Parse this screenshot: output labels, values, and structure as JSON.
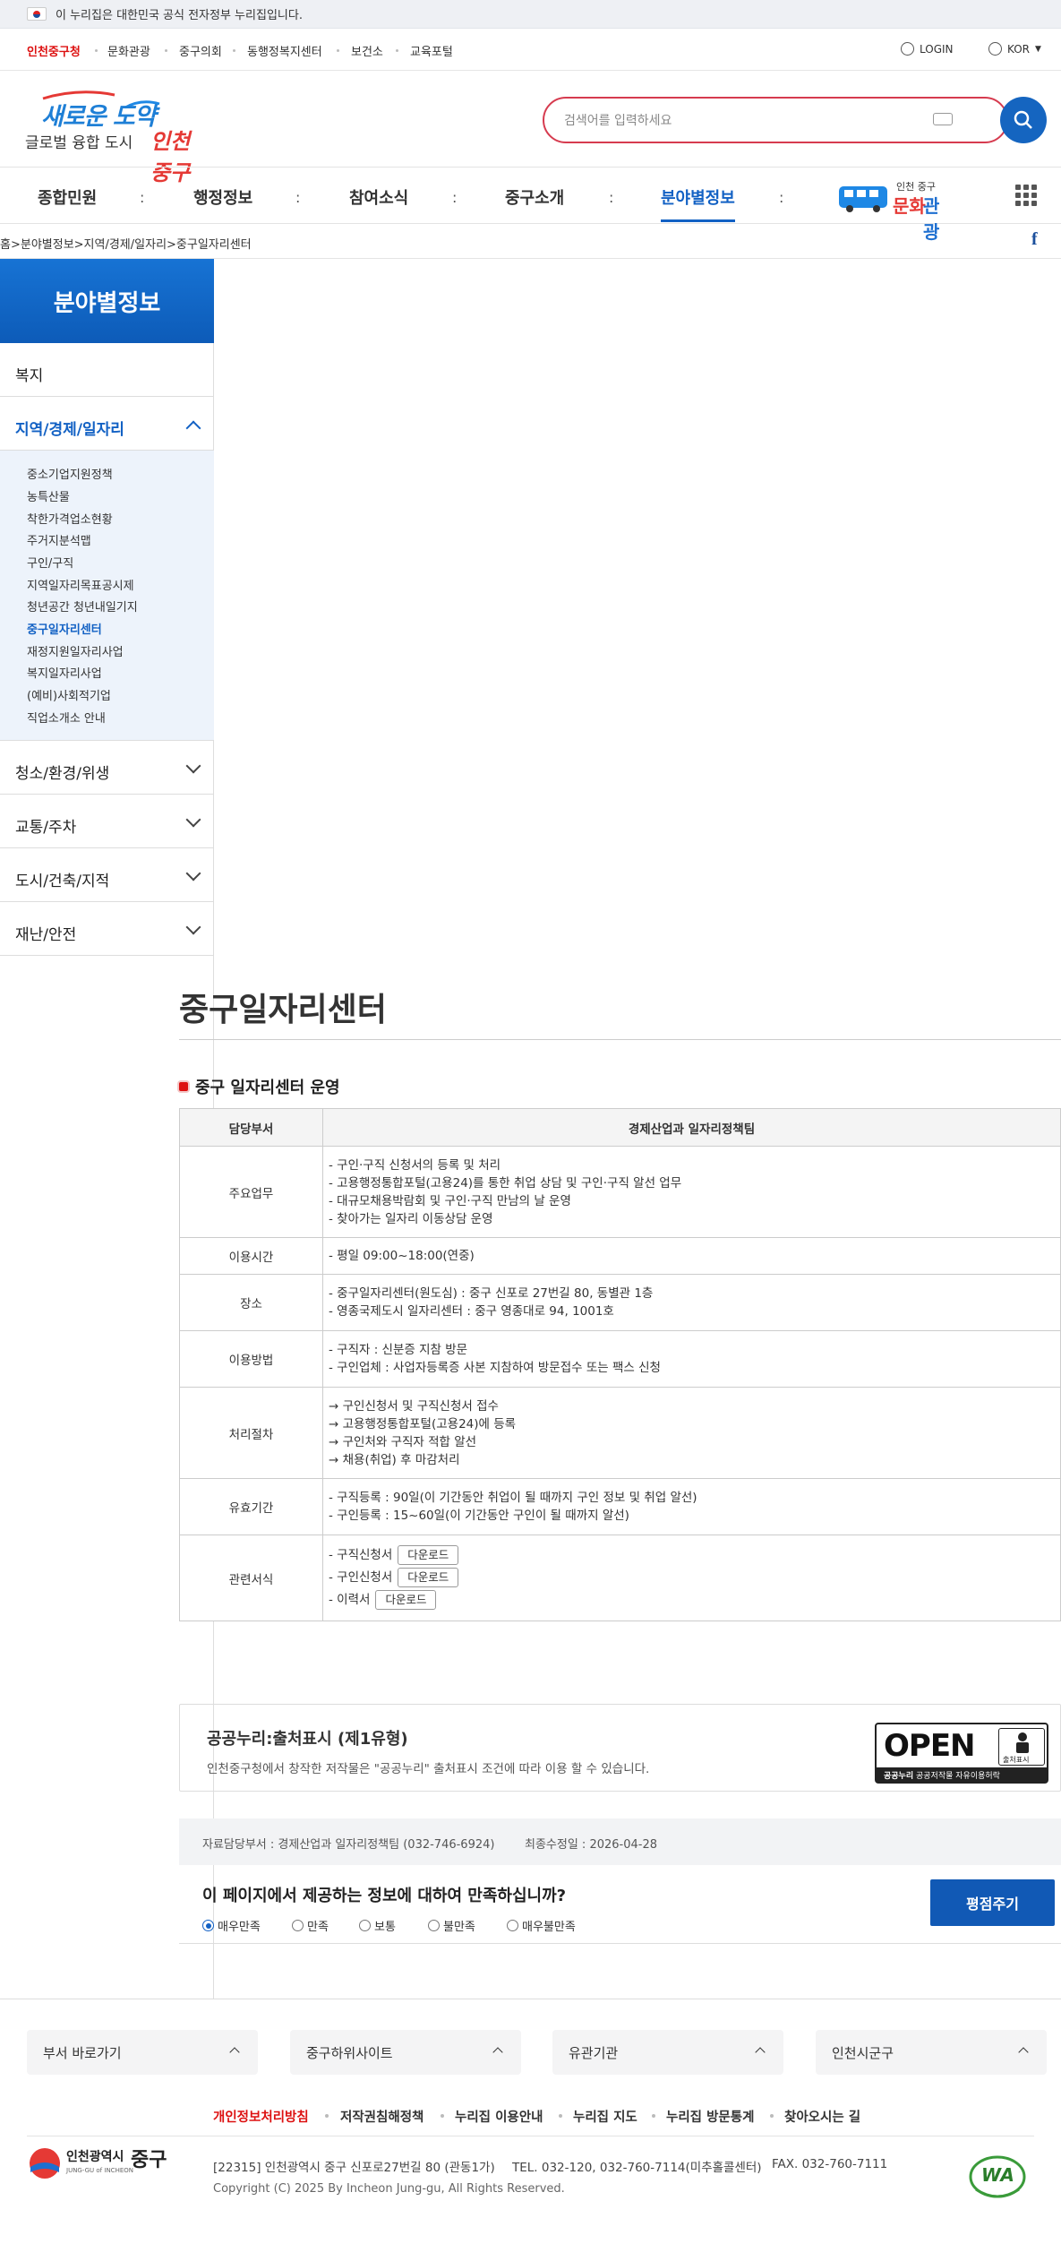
{
  "gov_banner": {
    "text": "이 누리집은 대한민국 공식 전자정부 누리집입니다."
  },
  "util_links": [
    "인천중구청",
    "문화관광",
    "중구의회",
    "동행정복지센터",
    "보건소",
    "교육포털"
  ],
  "util_right": {
    "login": "LOGIN",
    "lang": "KOR"
  },
  "logo": {
    "slogan_top": "새로운 도약",
    "slogan_bottom_a": "글로벌 융합 도시",
    "slogan_bottom_b": "인천 중구"
  },
  "search": {
    "placeholder": "검색어를 입력하세요"
  },
  "gnb": [
    "종합민원",
    "행정정보",
    "참여소식",
    "중구소개",
    "분야별정보"
  ],
  "gnb_active": "분야별정보",
  "culture_banner": {
    "small": "인천 중구",
    "big_a": "문화",
    "big_b": "관광"
  },
  "breadcrumb": "홈>분야별정보>지역/경제/일자리>중구일자리센터",
  "sidebar": {
    "title": "분야별정보",
    "menu": [
      "복지",
      "지역/경제/일자리",
      "청소/환경/위생",
      "교통/주차",
      "도시/건축/지적",
      "재난/안전"
    ],
    "sub": [
      "중소기업지원정책",
      "농특산물",
      "착한가격업소현황",
      "주거지분석맵",
      "구인/구직",
      "지역일자리목표공시제",
      "청년공간 청년내일기지",
      "중구일자리센터",
      "재정지원일자리사업",
      "복지일자리사업",
      "(예비)사회적기업",
      "직업소개소 안내"
    ],
    "sub_active": "중구일자리센터"
  },
  "page": {
    "title": "중구일자리센터",
    "section": "중구 일자리센터 운영"
  },
  "table": {
    "head": [
      "담당부서",
      "경제산업과 일자리정책팀"
    ],
    "rows": [
      {
        "label": "주요업무",
        "lines": [
          "- 구인·구직 신청서의 등록 및 처리",
          "- 고용행정통합포털(고용24)를 통한 취업 상담 및 구인·구직 알선 업무",
          "- 대규모채용박람회 및 구인·구직 만남의 날 운영",
          "- 찾아가는 일자리 이동상담 운영"
        ]
      },
      {
        "label": "이용시간",
        "lines": [
          "- 평일 09:00~18:00(연중)"
        ]
      },
      {
        "label": "장소",
        "lines": [
          "- 중구일자리센터(원도심) : 중구 신포로 27번길 80, 동별관 1층",
          "- 영종국제도시 일자리센터 : 중구 영종대로 94, 1001호"
        ]
      },
      {
        "label": "이용방법",
        "lines": [
          "- 구직자 : 신분증 지참 방문",
          "- 구인업체 : 사업자등록증 사본 지참하여 방문접수 또는 팩스 신청"
        ]
      },
      {
        "label": "처리절차",
        "lines": [
          "→ 구인신청서 및 구직신청서 접수",
          "→ 고용행정통합포털(고용24)에 등록",
          "→ 구인처와 구직자 적합 알선",
          "→ 채용(취업) 후 마감처리"
        ]
      },
      {
        "label": "유효기간",
        "lines": [
          "- 구직등록 : 90일(이 기간동안 취업이 될 때까지 구인 정보 및 취업 알선)",
          "- 구인등록 : 15~60일(이 기간동안 구인이 될 때까지 알선)"
        ]
      }
    ],
    "forms_label": "관련서식",
    "forms": [
      "- 구직신청서",
      "- 구인신청서",
      "- 이력서"
    ],
    "download": "다운로드"
  },
  "kogl": {
    "title": "공공누리:출처표시 (제1유형)",
    "desc": "인천중구청에서 창작한 저작물은 \"공공누리\" 출처표시 조건에 따라 이용 할 수 있습니다.",
    "open": "OPEN",
    "badge_small": "출처표시",
    "badge_bottom_a": "공공누리",
    "badge_bottom_b": "공공저작물 자유이용허락"
  },
  "info": {
    "dept": "자료담당부서 : 경제산업과 일자리정책팀  (032-746-6924)",
    "updated": "최종수정일 : 2026-04-28"
  },
  "survey": {
    "question": "이 페이지에서 제공하는 정보에 대하여 만족하십니까?",
    "options": [
      "매우만족",
      "만족",
      "보통",
      "불만족",
      "매우불만족"
    ],
    "selected": "매우만족",
    "button": "평점주기"
  },
  "footer": {
    "boxes": [
      "부서 바로가기",
      "중구하위사이트",
      "유관기관",
      "인천시군구"
    ],
    "links": [
      "개인정보처리방침",
      "저작권침해정책",
      "누리집 이용안내",
      "누리집 지도",
      "누리집 방문통계",
      "찾아오시는 길"
    ],
    "logo_a": "인천광역시",
    "logo_b": "중구",
    "logo_en": "JUNG-GU of INCHEON",
    "address": "[22315] 인천광역시 중구 신포로27번길 80 (관동1가)",
    "tel": "TEL. 032-120, 032-760-7114(미추홀콜센터)",
    "fax": "FAX. 032-760-7111",
    "copyright": "Copyright (C) 2025 By Incheon Jung-gu, All Rights Reserved.",
    "wa": "WA"
  }
}
